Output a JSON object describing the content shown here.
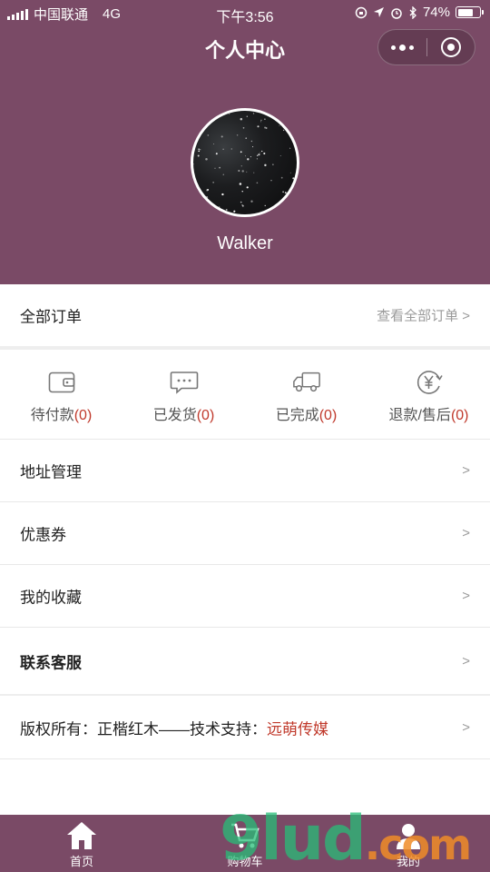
{
  "status_bar": {
    "carrier": "中国联通",
    "network": "4G",
    "time": "下午3:56",
    "battery": "74%",
    "battery_level": 0.74
  },
  "header": {
    "title": "个人中心",
    "username": "Walker",
    "background_color": "#7a4a66"
  },
  "orders": {
    "all_label": "全部订单",
    "view_all_label": "查看全部订单 >",
    "items": [
      {
        "label": "待付款",
        "count": "(0)",
        "icon": "wallet-icon"
      },
      {
        "label": "已发货",
        "count": "(0)",
        "icon": "message-icon"
      },
      {
        "label": "已完成",
        "count": "(0)",
        "icon": "truck-icon"
      },
      {
        "label": "退款/售后",
        "count": "(0)",
        "icon": "yuan-refund-icon"
      }
    ]
  },
  "menu": [
    {
      "label": "地址管理",
      "chevron": ">"
    },
    {
      "label": "优惠券",
      "chevron": ">"
    },
    {
      "label": "我的收藏",
      "chevron": ">"
    },
    {
      "label": "联系客服",
      "chevron": ">"
    }
  ],
  "copyright": {
    "prefix": "版权所有：正楷红木——技术支持：",
    "highlight": "远萌传媒",
    "chevron": ">"
  },
  "tabbar": [
    {
      "label": "首页",
      "icon": "home-icon"
    },
    {
      "label": "购物车",
      "icon": "cart-icon"
    },
    {
      "label": "我的",
      "icon": "user-icon"
    }
  ],
  "watermark": {
    "text": "9lud",
    "suffix": ".com"
  },
  "colors": {
    "accent": "#7a4a66",
    "count_red": "#c0392b"
  }
}
